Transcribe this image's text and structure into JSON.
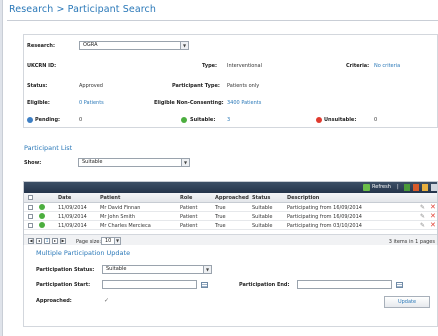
{
  "page": {
    "title": "Research > Participant Search"
  },
  "summary": {
    "research_label": "Research:",
    "research_value": "OGRA",
    "ukcrn_label": "UKCRN ID:",
    "ukcrn_value": "",
    "type_label": "Type:",
    "type_value": "Interventional",
    "criteria_label": "Criteria:",
    "criteria_value": "No criteria",
    "status_label": "Status:",
    "status_value": "Approved",
    "ptype_label": "Participant Type:",
    "ptype_value": "Patients only",
    "eligible_label": "Eligible:",
    "eligible_value": "0 Patients",
    "enc_label": "Eligible Non-Consenting:",
    "enc_value": "3400 Patients",
    "pending_label": "Pending:",
    "pending_value": "0",
    "suitable_label": "Suitable:",
    "suitable_value": "3",
    "unsuitable_label": "Unsuitable:",
    "unsuitable_value": "0"
  },
  "list": {
    "title": "Participant List",
    "show_label": "Show:",
    "show_value": "Suitable"
  },
  "grid": {
    "refresh_label": "Refresh",
    "columns": [
      "Date",
      "Patient",
      "Role",
      "Approached",
      "Status",
      "Description"
    ],
    "rows": [
      {
        "date": "11/09/2014",
        "patient": "Mr David Finnan",
        "role": "Patient",
        "approached": "True",
        "status": "Suitable",
        "description": "Participating from 16/09/2014"
      },
      {
        "date": "11/09/2014",
        "patient": "Mr John Smith",
        "role": "Patient",
        "approached": "True",
        "status": "Suitable",
        "description": "Participating from 16/09/2014"
      },
      {
        "date": "11/09/2014",
        "patient": "Mr Charles Mercieca",
        "role": "Patient",
        "approached": "True",
        "status": "Suitable",
        "description": "Participating from 03/10/2014"
      }
    ],
    "page_number": "1",
    "page_size_label": "Page size:",
    "page_size_value": "10",
    "items_info": "3 items in 1 pages"
  },
  "multi": {
    "title": "Multiple Participation Update",
    "status_label": "Participation Status:",
    "status_value": "Suitable",
    "start_label": "Participation Start:",
    "end_label": "Participation End:",
    "approached_label": "Approached:",
    "update_label": "Update"
  },
  "colors": {
    "accent": "#2a78b8",
    "green": "#4cae3f",
    "red": "#e03a2e",
    "pending_blue": "#3d7fc4"
  }
}
